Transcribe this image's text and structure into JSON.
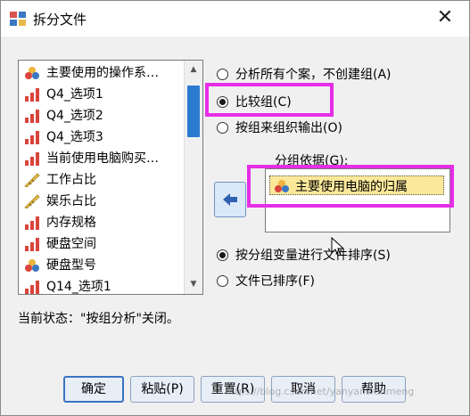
{
  "window": {
    "title": "拆分文件",
    "close_glyph": "✕"
  },
  "variables": {
    "items": [
      {
        "label": "主要使用的操作系…",
        "icon": "nominal-icon"
      },
      {
        "label": "Q4_选项1",
        "icon": "ordinal-icon"
      },
      {
        "label": "Q4_选项2",
        "icon": "ordinal-icon"
      },
      {
        "label": "Q4_选项3",
        "icon": "ordinal-icon"
      },
      {
        "label": "当前使用电脑购买…",
        "icon": "ordinal-icon"
      },
      {
        "label": "工作占比",
        "icon": "scale-icon"
      },
      {
        "label": "娱乐占比",
        "icon": "scale-icon"
      },
      {
        "label": "内存规格",
        "icon": "ordinal-icon"
      },
      {
        "label": "硬盘空间",
        "icon": "ordinal-icon"
      },
      {
        "label": "硬盘型号",
        "icon": "nominal-icon"
      },
      {
        "label": "Q14_选项1",
        "icon": "ordinal-icon"
      }
    ],
    "scrollbar": {
      "up": "▲",
      "down": "▼"
    }
  },
  "mode_options": [
    {
      "label": "分析所有个案，不创建组(A)",
      "checked": false
    },
    {
      "label": "比较组(C)",
      "checked": true
    },
    {
      "label": "按组来组织输出(O)",
      "checked": false
    }
  ],
  "groupby": {
    "label": "分组依据(G):",
    "items": [
      {
        "label": "主要使用电脑的归属",
        "icon": "nominal-icon"
      }
    ]
  },
  "sort_options": [
    {
      "label": "按分组变量进行文件排序(S)",
      "checked": true
    },
    {
      "label": "文件已排序(F)",
      "checked": false
    }
  ],
  "status": "当前状态：\"按组分析\"关闭。",
  "buttons": {
    "ok": "确定",
    "paste": "粘贴(P)",
    "reset": "重置(R)",
    "cancel": "取消",
    "help": "帮助"
  },
  "watermark": "https://blog.csdn.net/yanyanwenmeng",
  "colors": {
    "highlight": "#e62ee6",
    "selected_item_bg": "#fbe89a",
    "scroll_thumb": "#2b7bd1",
    "default_button_border": "#3c72c4"
  }
}
